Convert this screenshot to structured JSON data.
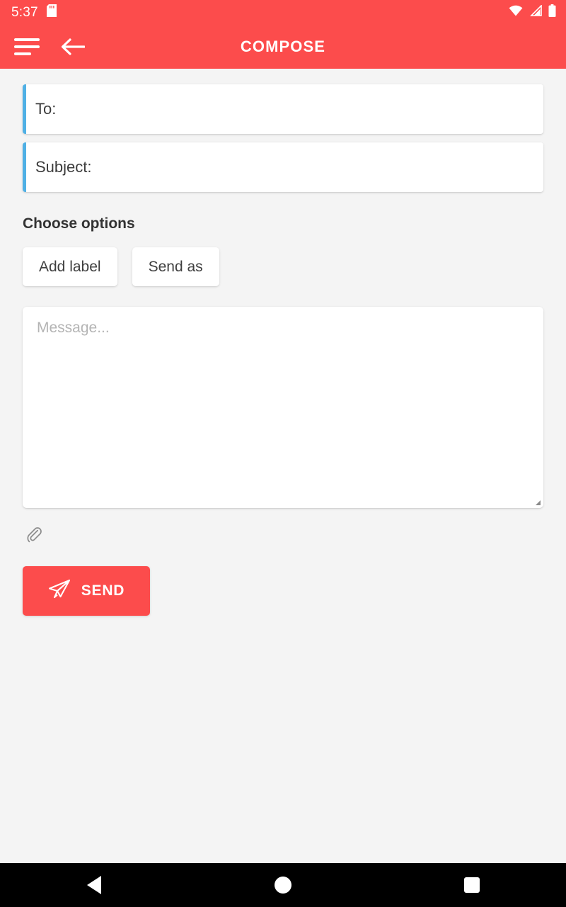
{
  "status_bar": {
    "time": "5:37",
    "icons": {
      "sdcard": "sdcard-icon",
      "wifi": "wifi-icon",
      "signal": "signal-icon",
      "battery": "battery-icon"
    }
  },
  "app_bar": {
    "title": "COMPOSE",
    "menu_icon": "hamburger-menu-icon",
    "back_icon": "back-arrow-icon"
  },
  "form": {
    "to": {
      "label": "To:",
      "value": "",
      "placeholder": ""
    },
    "subject": {
      "label": "Subject:",
      "value": "",
      "placeholder": ""
    },
    "options_title": "Choose options",
    "options": [
      {
        "label": "Add label"
      },
      {
        "label": "Send as"
      }
    ],
    "message": {
      "value": "",
      "placeholder": "Message..."
    },
    "attach": {
      "icon": "paperclip-icon"
    },
    "send": {
      "label": "SEND",
      "icon": "paper-plane-icon"
    }
  },
  "nav_bar": {
    "back": "nav-back-icon",
    "home": "nav-home-icon",
    "recents": "nav-recents-icon"
  },
  "colors": {
    "primary": "#FC4C4C",
    "accent_blue": "#4FB0E5",
    "background": "#F4F4F4",
    "card": "#FFFFFF",
    "text": "#3C3C3C",
    "placeholder": "#B4B4B4"
  }
}
